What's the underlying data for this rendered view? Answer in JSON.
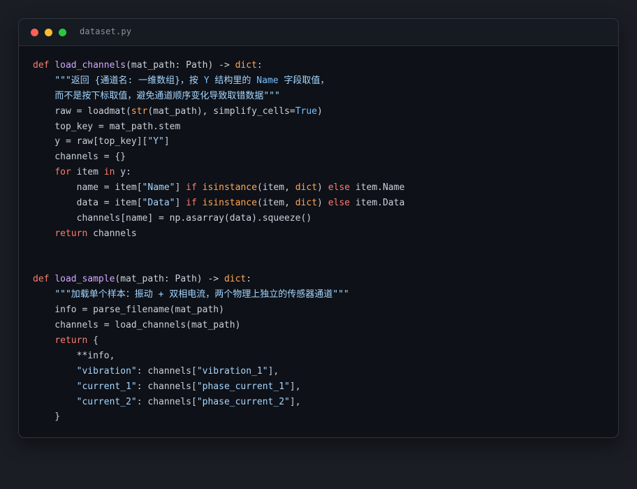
{
  "window": {
    "filename": "dataset.py",
    "colors": {
      "background": "#1a1d24",
      "editor": "#0e1117",
      "keyword": "#ff7b72",
      "function": "#d2a8ff",
      "builtin": "#ffa657",
      "string": "#a5d6ff",
      "constant": "#79c0ff",
      "text": "#c9d1d9"
    }
  },
  "code": {
    "lines": [
      [
        [
          "kw",
          "def"
        ],
        [
          "t",
          " "
        ],
        [
          "fn",
          "load_channels"
        ],
        [
          "t",
          "(mat_path: Path) -> "
        ],
        [
          "bi",
          "dict"
        ],
        [
          "t",
          ":"
        ]
      ],
      [
        [
          "t",
          "    "
        ],
        [
          "str",
          "\"\"\"返回 {通道名: 一维数组}，按 "
        ],
        [
          "cst",
          "Y"
        ],
        [
          "str",
          " 结构里的 "
        ],
        [
          "cst",
          "Name"
        ],
        [
          "str",
          " 字段取值，"
        ]
      ],
      [
        [
          "t",
          "    "
        ],
        [
          "str",
          "而不是按下标取值，避免通道顺序变化导致取错数据\"\"\""
        ]
      ],
      [
        [
          "t",
          "    raw = loadmat("
        ],
        [
          "bi",
          "str"
        ],
        [
          "t",
          "(mat_path), simplify_cells="
        ],
        [
          "cst",
          "True"
        ],
        [
          "t",
          ")"
        ]
      ],
      [
        [
          "t",
          "    top_key = mat_path.stem"
        ]
      ],
      [
        [
          "t",
          "    y = raw[top_key]["
        ],
        [
          "str",
          "\"Y\""
        ],
        [
          "t",
          "]"
        ]
      ],
      [
        [
          "t",
          "    channels = {}"
        ]
      ],
      [
        [
          "t",
          "    "
        ],
        [
          "kw",
          "for"
        ],
        [
          "t",
          " item "
        ],
        [
          "kw",
          "in"
        ],
        [
          "t",
          " y:"
        ]
      ],
      [
        [
          "t",
          "        name = item["
        ],
        [
          "str",
          "\"Name\""
        ],
        [
          "t",
          "] "
        ],
        [
          "kw",
          "if"
        ],
        [
          "t",
          " "
        ],
        [
          "bi",
          "isinstance"
        ],
        [
          "t",
          "(item, "
        ],
        [
          "bi",
          "dict"
        ],
        [
          "t",
          ") "
        ],
        [
          "kw",
          "else"
        ],
        [
          "t",
          " item.Name"
        ]
      ],
      [
        [
          "t",
          "        data = item["
        ],
        [
          "str",
          "\"Data\""
        ],
        [
          "t",
          "] "
        ],
        [
          "kw",
          "if"
        ],
        [
          "t",
          " "
        ],
        [
          "bi",
          "isinstance"
        ],
        [
          "t",
          "(item, "
        ],
        [
          "bi",
          "dict"
        ],
        [
          "t",
          ") "
        ],
        [
          "kw",
          "else"
        ],
        [
          "t",
          " item.Data"
        ]
      ],
      [
        [
          "t",
          "        channels[name] = np.asarray(data).squeeze()"
        ]
      ],
      [
        [
          "t",
          "    "
        ],
        [
          "kw",
          "return"
        ],
        [
          "t",
          " channels"
        ]
      ],
      [],
      [],
      [
        [
          "kw",
          "def"
        ],
        [
          "t",
          " "
        ],
        [
          "fn",
          "load_sample"
        ],
        [
          "t",
          "(mat_path: Path) -> "
        ],
        [
          "bi",
          "dict"
        ],
        [
          "t",
          ":"
        ]
      ],
      [
        [
          "t",
          "    "
        ],
        [
          "str",
          "\"\"\"加载单个样本：振动 + 双相电流，两个物理上独立的传感器通道\"\"\""
        ]
      ],
      [
        [
          "t",
          "    info = parse_filename(mat_path)"
        ]
      ],
      [
        [
          "t",
          "    channels = load_channels(mat_path)"
        ]
      ],
      [
        [
          "t",
          "    "
        ],
        [
          "kw",
          "return"
        ],
        [
          "t",
          " {"
        ]
      ],
      [
        [
          "t",
          "        **info,"
        ]
      ],
      [
        [
          "t",
          "        "
        ],
        [
          "str",
          "\"vibration\""
        ],
        [
          "t",
          ": channels["
        ],
        [
          "str",
          "\"vibration_1\""
        ],
        [
          "t",
          "],"
        ]
      ],
      [
        [
          "t",
          "        "
        ],
        [
          "str",
          "\"current_1\""
        ],
        [
          "t",
          ": channels["
        ],
        [
          "str",
          "\"phase_current_1\""
        ],
        [
          "t",
          "],"
        ]
      ],
      [
        [
          "t",
          "        "
        ],
        [
          "str",
          "\"current_2\""
        ],
        [
          "t",
          ": channels["
        ],
        [
          "str",
          "\"phase_current_2\""
        ],
        [
          "t",
          "],"
        ]
      ],
      [
        [
          "t",
          "    }"
        ]
      ]
    ]
  }
}
